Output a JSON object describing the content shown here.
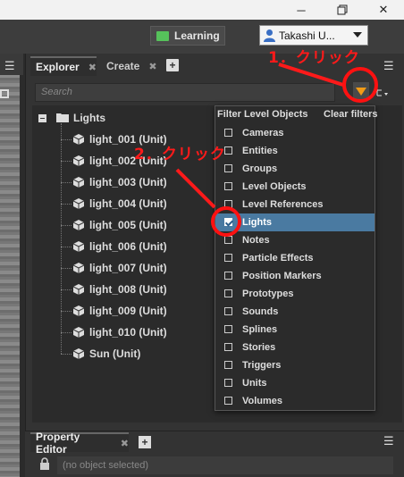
{
  "window": {
    "minimize_icon": "minimize-icon",
    "restore_icon": "restore-icon",
    "close_icon": "close-icon"
  },
  "toolbar": {
    "learning_label": "Learning",
    "user_name": "Takashi U..."
  },
  "explorer": {
    "tabs": [
      {
        "label": "Explorer"
      },
      {
        "label": "Create"
      }
    ],
    "search_placeholder": "Search",
    "tree": {
      "root": "Lights",
      "children": [
        "light_001 (Unit)",
        "light_002 (Unit)",
        "light_003 (Unit)",
        "light_004 (Unit)",
        "light_005 (Unit)",
        "light_006 (Unit)",
        "light_007 (Unit)",
        "light_008 (Unit)",
        "light_009 (Unit)",
        "light_010 (Unit)",
        "Sun (Unit)"
      ]
    }
  },
  "filter_menu": {
    "title": "Filter Level Objects",
    "clear_label": "Clear filters",
    "items": [
      {
        "label": "Cameras",
        "checked": false
      },
      {
        "label": "Entities",
        "checked": false
      },
      {
        "label": "Groups",
        "checked": false
      },
      {
        "label": "Level Objects",
        "checked": false
      },
      {
        "label": "Level References",
        "checked": false
      },
      {
        "label": "Lights",
        "checked": true
      },
      {
        "label": "Notes",
        "checked": false
      },
      {
        "label": "Particle Effects",
        "checked": false
      },
      {
        "label": "Position Markers",
        "checked": false
      },
      {
        "label": "Prototypes",
        "checked": false
      },
      {
        "label": "Sounds",
        "checked": false
      },
      {
        "label": "Splines",
        "checked": false
      },
      {
        "label": "Stories",
        "checked": false
      },
      {
        "label": "Triggers",
        "checked": false
      },
      {
        "label": "Units",
        "checked": false
      },
      {
        "label": "Volumes",
        "checked": false
      }
    ]
  },
  "annotations": {
    "step1": "1．クリック",
    "step2": "2．クリック",
    "color": "#ff1a1a"
  },
  "property_editor": {
    "tab_label": "Property Editor",
    "field_placeholder": "(no object selected)"
  },
  "colors": {
    "accent_selected": "#4a7aa1",
    "filter_icon": "#f29b16",
    "learning_icon": "#56c25b"
  }
}
